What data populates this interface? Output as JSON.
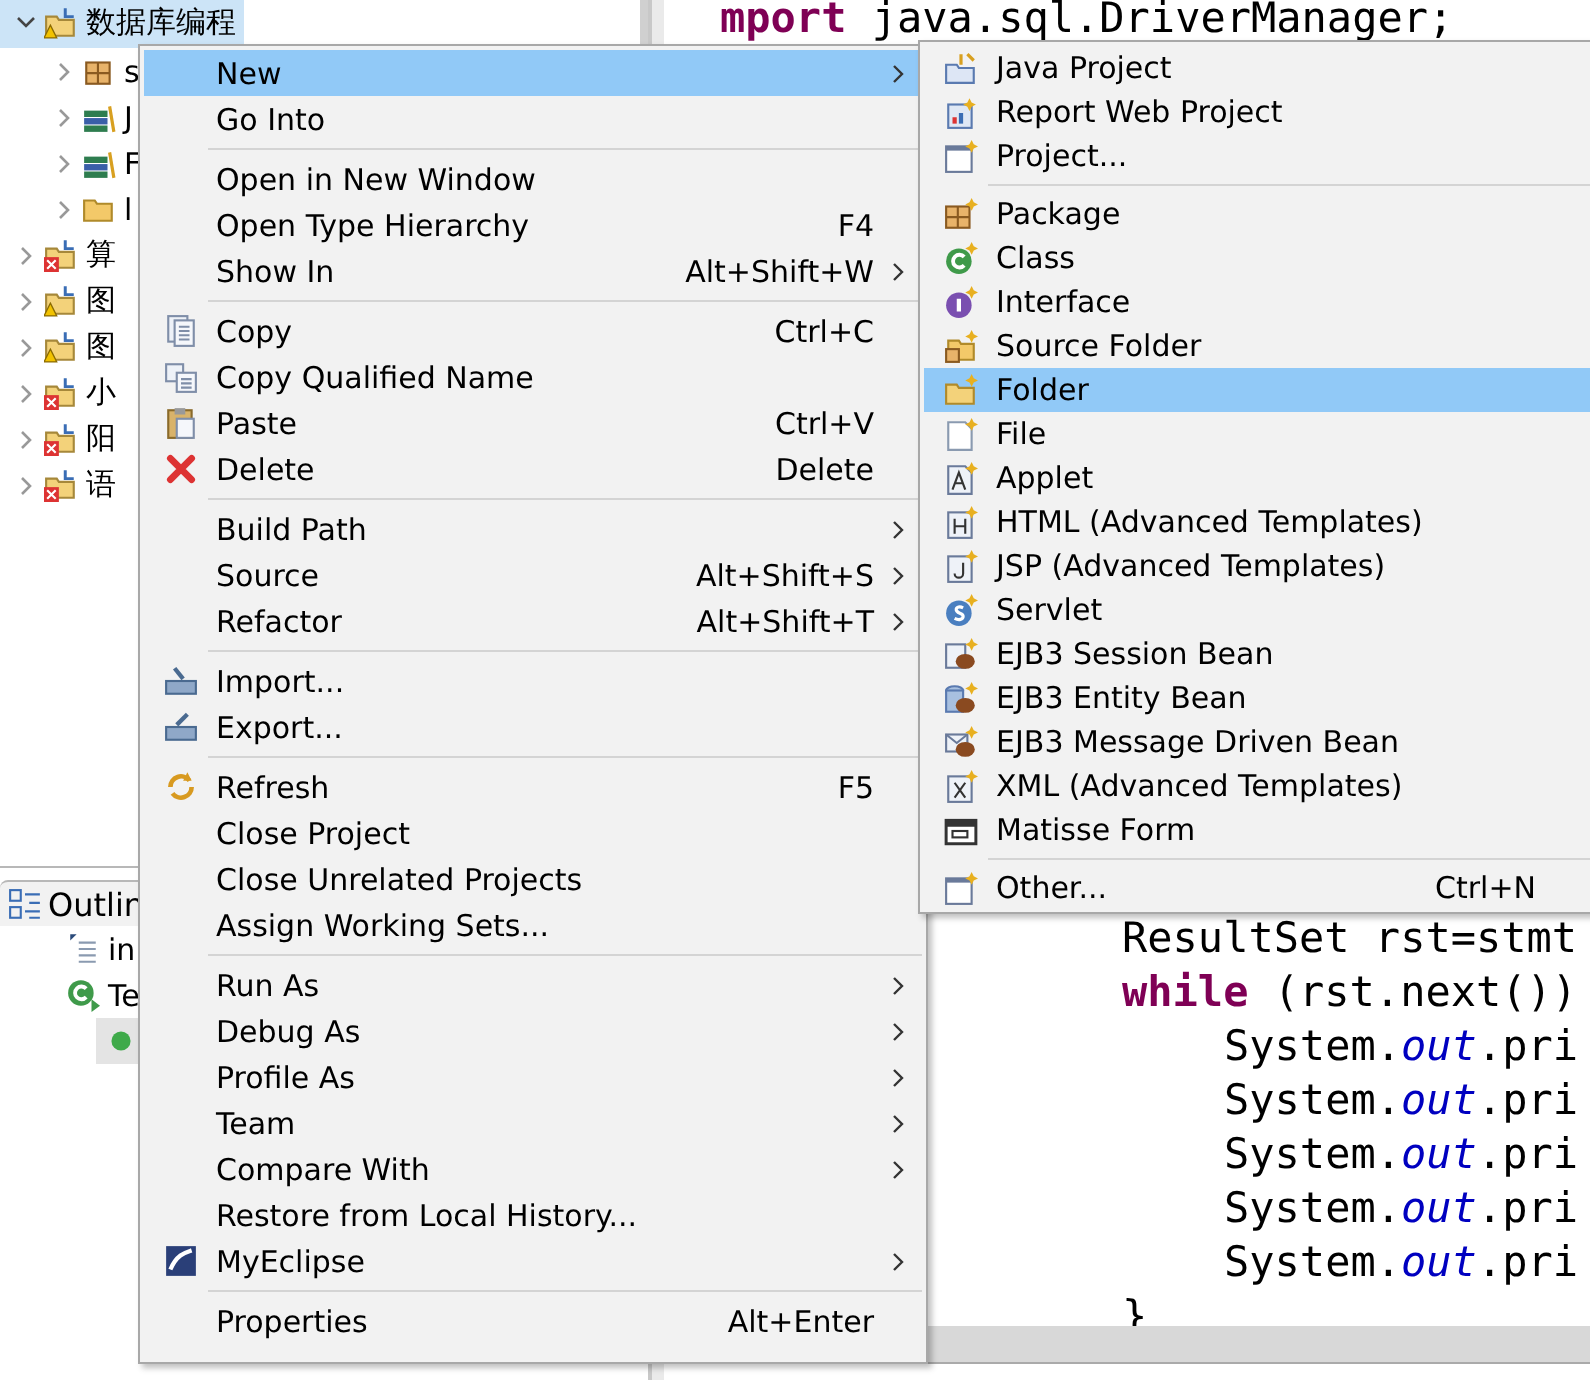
{
  "explorer": {
    "items": [
      {
        "label": "数据库编程",
        "selected": true,
        "expanded": true,
        "warning": true,
        "error": false,
        "children": [
          {
            "label": "s",
            "expanded": false
          },
          {
            "label": "J",
            "expanded": false
          },
          {
            "label": "F",
            "expanded": false
          },
          {
            "label": "l",
            "expanded": false
          }
        ]
      },
      {
        "label": "算",
        "selected": false,
        "expanded": false,
        "warning": false,
        "error": true
      },
      {
        "label": "图",
        "selected": false,
        "expanded": false,
        "warning": true,
        "error": false
      },
      {
        "label": "图",
        "selected": false,
        "expanded": false,
        "warning": true,
        "error": false
      },
      {
        "label": "小",
        "selected": false,
        "expanded": false,
        "warning": false,
        "error": true
      },
      {
        "label": "阳",
        "selected": false,
        "expanded": false,
        "warning": false,
        "error": true
      },
      {
        "label": "语",
        "selected": false,
        "expanded": false,
        "warning": false,
        "error": true
      }
    ]
  },
  "outline": {
    "tab": "Outlin",
    "items": [
      {
        "label": "in"
      },
      {
        "label": "Te",
        "children": [
          {
            "selected": true
          }
        ]
      }
    ]
  },
  "editor": {
    "header_line": {
      "segments": [
        {
          "kind": "keyword",
          "text": "mport"
        },
        {
          "kind": "plain",
          "text": " java.sql.DriverManager;"
        }
      ]
    },
    "body_lines": [
      {
        "segments": [
          {
            "kind": "plain",
            "text": "ResultSet rst=stmt"
          }
        ]
      },
      {
        "segments": [
          {
            "kind": "keyword",
            "text": "while"
          },
          {
            "kind": "plain",
            "text": " (rst.next())"
          }
        ],
        "children": [
          {
            "segments": [
              {
                "kind": "plain",
                "text": "System."
              },
              {
                "kind": "field",
                "text": "out"
              },
              {
                "kind": "plain",
                "text": ".pri"
              }
            ]
          },
          {
            "segments": [
              {
                "kind": "plain",
                "text": "System."
              },
              {
                "kind": "field",
                "text": "out"
              },
              {
                "kind": "plain",
                "text": ".pri"
              }
            ]
          },
          {
            "segments": [
              {
                "kind": "plain",
                "text": "System."
              },
              {
                "kind": "field",
                "text": "out"
              },
              {
                "kind": "plain",
                "text": ".pri"
              }
            ]
          },
          {
            "segments": [
              {
                "kind": "plain",
                "text": "System."
              },
              {
                "kind": "field",
                "text": "out"
              },
              {
                "kind": "plain",
                "text": ".pri"
              }
            ]
          },
          {
            "segments": [
              {
                "kind": "plain",
                "text": "System."
              },
              {
                "kind": "field",
                "text": "out"
              },
              {
                "kind": "plain",
                "text": ".pri"
              }
            ]
          }
        ]
      },
      {
        "segments": [
          {
            "kind": "plain",
            "text": "}"
          }
        ]
      }
    ]
  },
  "context_menu": {
    "items": [
      {
        "kind": "item",
        "label": "New",
        "selected": true,
        "submenu": true
      },
      {
        "kind": "item",
        "label": "Go Into",
        "selected": false,
        "submenu": false
      },
      {
        "kind": "separator"
      },
      {
        "kind": "item",
        "label": "Open in New Window",
        "selected": false,
        "submenu": false
      },
      {
        "kind": "item",
        "label": "Open Type Hierarchy",
        "shortcut": "F4",
        "selected": false,
        "submenu": false
      },
      {
        "kind": "item",
        "label": "Show In",
        "shortcut": "Alt+Shift+W",
        "selected": false,
        "submenu": true
      },
      {
        "kind": "separator"
      },
      {
        "kind": "item",
        "label": "Copy",
        "shortcut": "Ctrl+C",
        "selected": false,
        "submenu": false
      },
      {
        "kind": "item",
        "label": "Copy Qualified Name",
        "selected": false,
        "submenu": false
      },
      {
        "kind": "item",
        "label": "Paste",
        "shortcut": "Ctrl+V",
        "selected": false,
        "submenu": false
      },
      {
        "kind": "item",
        "label": "Delete",
        "shortcut": "Delete",
        "selected": false,
        "submenu": false
      },
      {
        "kind": "separator"
      },
      {
        "kind": "item",
        "label": "Build Path",
        "selected": false,
        "submenu": true
      },
      {
        "kind": "item",
        "label": "Source",
        "shortcut": "Alt+Shift+S",
        "selected": false,
        "submenu": true
      },
      {
        "kind": "item",
        "label": "Refactor",
        "shortcut": "Alt+Shift+T",
        "selected": false,
        "submenu": true
      },
      {
        "kind": "separator"
      },
      {
        "kind": "item",
        "label": "Import...",
        "selected": false,
        "submenu": false
      },
      {
        "kind": "item",
        "label": "Export...",
        "selected": false,
        "submenu": false
      },
      {
        "kind": "separator"
      },
      {
        "kind": "item",
        "label": "Refresh",
        "shortcut": "F5",
        "selected": false,
        "submenu": false
      },
      {
        "kind": "item",
        "label": "Close Project",
        "selected": false,
        "submenu": false
      },
      {
        "kind": "item",
        "label": "Close Unrelated Projects",
        "selected": false,
        "submenu": false
      },
      {
        "kind": "item",
        "label": "Assign Working Sets...",
        "selected": false,
        "submenu": false
      },
      {
        "kind": "separator"
      },
      {
        "kind": "item",
        "label": "Run As",
        "selected": false,
        "submenu": true
      },
      {
        "kind": "item",
        "label": "Debug As",
        "selected": false,
        "submenu": true
      },
      {
        "kind": "item",
        "label": "Profile As",
        "selected": false,
        "submenu": true
      },
      {
        "kind": "item",
        "label": "Team",
        "selected": false,
        "submenu": true
      },
      {
        "kind": "item",
        "label": "Compare With",
        "selected": false,
        "submenu": true
      },
      {
        "kind": "item",
        "label": "Restore from Local History...",
        "selected": false,
        "submenu": false
      },
      {
        "kind": "item",
        "label": "MyEclipse",
        "selected": false,
        "submenu": true
      },
      {
        "kind": "separator"
      },
      {
        "kind": "item",
        "label": "Properties",
        "shortcut": "Alt+Enter",
        "selected": false,
        "submenu": false
      }
    ]
  },
  "submenu": {
    "items": [
      {
        "kind": "item",
        "label": "Java Project",
        "selected": false
      },
      {
        "kind": "item",
        "label": "Report Web Project",
        "selected": false
      },
      {
        "kind": "item",
        "label": "Project...",
        "selected": false
      },
      {
        "kind": "separator"
      },
      {
        "kind": "item",
        "label": "Package",
        "selected": false
      },
      {
        "kind": "item",
        "label": "Class",
        "selected": false
      },
      {
        "kind": "item",
        "label": "Interface",
        "selected": false
      },
      {
        "kind": "item",
        "label": "Source Folder",
        "selected": false
      },
      {
        "kind": "item",
        "label": "Folder",
        "selected": true
      },
      {
        "kind": "item",
        "label": "File",
        "selected": false
      },
      {
        "kind": "item",
        "label": "Applet",
        "selected": false
      },
      {
        "kind": "item",
        "label": "HTML (Advanced Templates)",
        "selected": false
      },
      {
        "kind": "item",
        "label": "JSP (Advanced Templates)",
        "selected": false
      },
      {
        "kind": "item",
        "label": "Servlet",
        "selected": false
      },
      {
        "kind": "item",
        "label": "EJB3 Session Bean",
        "selected": false
      },
      {
        "kind": "item",
        "label": "EJB3 Entity Bean",
        "selected": false
      },
      {
        "kind": "item",
        "label": "EJB3 Message Driven Bean",
        "selected": false
      },
      {
        "kind": "item",
        "label": "XML (Advanced Templates)",
        "selected": false
      },
      {
        "kind": "item",
        "label": "Matisse Form",
        "selected": false
      },
      {
        "kind": "separator"
      },
      {
        "kind": "item",
        "label": "Other...",
        "shortcut": "Ctrl+N",
        "selected": false
      }
    ]
  }
}
